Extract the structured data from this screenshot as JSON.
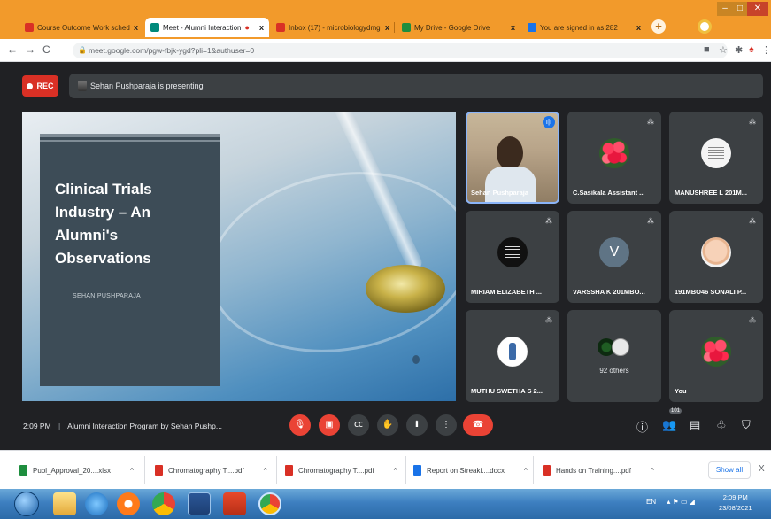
{
  "browser": {
    "tabs": [
      {
        "label": "Course Outcome Work sched",
        "favicon_color": "#d93025"
      },
      {
        "label": "Meet - Alumni Interaction",
        "favicon_color": "#00897b",
        "active": true
      },
      {
        "label": "Inbox (17) - microbiologydmg",
        "favicon_color": "#d93025"
      },
      {
        "label": "My Drive - Google Drive",
        "favicon_color": "#1e8e3e"
      },
      {
        "label": "You are signed in as 282",
        "favicon_color": "#1a73e8"
      }
    ],
    "tab_close": "x",
    "new_tab": "+",
    "url": "meet.google.com/pgw-fbjk-ygd?pli=1&authuser=0"
  },
  "meet": {
    "rec_label": "REC",
    "presenting_text": "Sehan Pushparaja is presenting",
    "slide": {
      "title": "Clinical Trials Industry – An Alumni's Observations",
      "author": "SEHAN PUSHPARAJA"
    },
    "participants": [
      {
        "name": "Sehan Pushparaja",
        "avatar": "video",
        "speaking": true
      },
      {
        "name": "C.Sasikala Assistant ...",
        "avatar": "flowers",
        "muted": true
      },
      {
        "name": "MANUSHREE L 201M...",
        "avatar": "text",
        "muted": true
      },
      {
        "name": "MIRIAM ELIZABETH ...",
        "avatar": "black-text",
        "muted": true
      },
      {
        "name": "VARSSHA K 201MBO...",
        "avatar": "letter",
        "letter": "V",
        "muted": true
      },
      {
        "name": "191MBO46 SONALI P...",
        "avatar": "baby",
        "muted": true
      },
      {
        "name": "MUTHU SWETHA S 2...",
        "avatar": "bottle",
        "muted": true
      },
      {
        "name": "",
        "others": "92 others"
      },
      {
        "name": "You",
        "avatar": "flowers",
        "muted": true
      }
    ],
    "time": "2:09 PM",
    "meeting_title": "Alumni Interaction Program by Sehan Pushp...",
    "participant_count": "101",
    "controls": [
      "mic-off-icon",
      "camera-off-icon",
      "captions-icon",
      "raise-hand-icon",
      "present-icon",
      "more-icon",
      "end-call-icon"
    ]
  },
  "downloads": {
    "items": [
      {
        "label": "Publ_Approval_20....xlsx",
        "color": "#1e8e3e"
      },
      {
        "label": "Chromatography T....pdf",
        "color": "#d93025"
      },
      {
        "label": "Chromatography T....pdf",
        "color": "#d93025"
      },
      {
        "label": "Report on Streaki....docx",
        "color": "#1a73e8"
      },
      {
        "label": "Hands on Training....pdf",
        "color": "#d93025"
      }
    ],
    "show_all": "Show all",
    "close": "X"
  },
  "taskbar": {
    "lang": "EN",
    "time": "2:09 PM",
    "date": "23/08/2021"
  }
}
